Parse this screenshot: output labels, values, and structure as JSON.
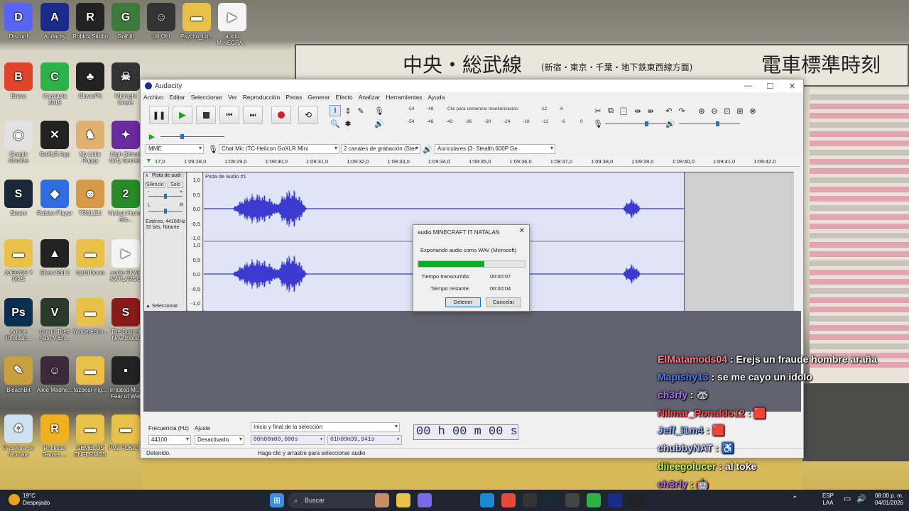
{
  "background_sign": {
    "text": "中央・総武線",
    "text2": "(新宿・東京・千葉・地下鉄東西線方面)",
    "text3": "電車標準時刻"
  },
  "desktop": {
    "icons": [
      {
        "label": "Discord",
        "color": "#5865f2",
        "glyph": "D"
      },
      {
        "label": "Audacity",
        "color": "#1a2b8a",
        "glyph": "A"
      },
      {
        "label": "Roblox Studio",
        "color": "#222",
        "glyph": "R"
      },
      {
        "label": "Golf It!",
        "color": "#3c7a3c",
        "glyph": "G"
      },
      {
        "label": "Uh Oh!",
        "color": "#333",
        "glyph": "☺"
      },
      {
        "label": "Psycho_Lo...",
        "color": "#e8c04a",
        "glyph": "▬"
      },
      {
        "label": "audio MINECRA...",
        "color": "#f4f4f4",
        "glyph": "▶"
      },
      {
        "label": "Brave",
        "color": "#e0442a",
        "glyph": "B"
      },
      {
        "label": "Camtasia 2019",
        "color": "#2db24a",
        "glyph": "C"
      },
      {
        "label": "CloverPit",
        "color": "#222",
        "glyph": "♣"
      },
      {
        "label": "Midnight Crane",
        "color": "#333",
        "glyph": "☠"
      },
      {
        "label": "Google Chrome",
        "color": "#e2e2e2",
        "glyph": "◉"
      },
      {
        "label": "GoXLR App",
        "color": "#222",
        "glyph": "✕"
      },
      {
        "label": "My Little Puppy",
        "color": "#e0b070",
        "glyph": "♞"
      },
      {
        "label": "High School Dirty Secrets",
        "color": "#6a2aa0",
        "glyph": "✦"
      },
      {
        "label": "Steam",
        "color": "#1b2838",
        "glyph": "S"
      },
      {
        "label": "Roblox Player",
        "color": "#2f6de0",
        "glyph": "◆"
      },
      {
        "label": "TROLEU",
        "color": "#d89a4a",
        "glyph": "☻"
      },
      {
        "label": "Violent Horror Sto...",
        "color": "#2a8a2a",
        "glyph": "2"
      },
      {
        "label": "JUEGOS Y MAS",
        "color": "#e8c04a",
        "glyph": "▬"
      },
      {
        "label": "Silent Still 2",
        "color": "#222",
        "glyph": "▲"
      },
      {
        "label": "UpOrDown",
        "color": "#e8c04a",
        "glyph": "▬"
      },
      {
        "label": "audio FNAF NATLARGO",
        "color": "#f4f4f4",
        "glyph": "▶"
      },
      {
        "label": "Adobe Photosh...",
        "color": "#0b2f4f",
        "glyph": "Ps"
      },
      {
        "label": "Grand Theft Auto V En...",
        "color": "#2a3a2a",
        "glyph": "V"
      },
      {
        "label": "YandereSim...",
        "color": "#e8c04a",
        "glyph": "▬"
      },
      {
        "label": "The Supper New Blood",
        "color": "#8a1a1a",
        "glyph": "S"
      },
      {
        "label": "BleachBit",
        "color": "#c8a040",
        "glyph": "✎"
      },
      {
        "label": "Alice Madne...",
        "color": "#3a2a3a",
        "glyph": "☺"
      },
      {
        "label": "fazbear-nig...",
        "color": "#e8c04a",
        "glyph": "▬"
      },
      {
        "label": "Irritated Mi... Fear of War",
        "color": "#222",
        "glyph": "▪"
      },
      {
        "label": "Papelera de reciclaje",
        "color": "#cfe0f0",
        "glyph": "♻"
      },
      {
        "label": "Rockstar Games ...",
        "color": "#f0b020",
        "glyph": "R"
      },
      {
        "label": "GEMELOS ENFERMOS",
        "color": "#e8c04a",
        "glyph": "▬"
      },
      {
        "label": "PVZ FUSION",
        "color": "#e8c04a",
        "glyph": "▬"
      }
    ]
  },
  "window": {
    "title": "Audacity",
    "controls": {
      "minimize": "—",
      "maximize": "☐",
      "close": "✕"
    },
    "menu": [
      "Archivo",
      "Editar",
      "Seleccionar",
      "Ver",
      "Reproducción",
      "Pistas",
      "Generar",
      "Efecto",
      "Analizar",
      "Herramientas",
      "Ayuda"
    ],
    "meter": {
      "click_text": "Clic para comenzar monitorización",
      "ticks_top": [
        "-54",
        "-48",
        "-12",
        "-6"
      ],
      "ticks_bottom": [
        "-54",
        "-48",
        "-42",
        "-36",
        "-30",
        "-24",
        "-18",
        "-12",
        "-6",
        "0"
      ]
    },
    "device": {
      "host": "MME",
      "mic": "Chat Mic (TC-Helicon GoXLR Mini",
      "channels": "2 canales de grabación (Ster",
      "output": "Auriculares (3- Stealth 600P Ge"
    },
    "ruler": {
      "start": "17,0",
      "ticks": [
        "1:09:28,0",
        "1:09:29,0",
        "1:09:30,0",
        "1:09:31,0",
        "1:09:32,0",
        "1:09:33,0",
        "1:09:34,0",
        "1:09:35,0",
        "1:09:36,0",
        "1:09:37,0",
        "1:09:38,0",
        "1:09:39,0",
        "1:09:40,0",
        "1:09:41,0",
        "1:09:42,0"
      ]
    },
    "track": {
      "menu_name": "Pista de audi",
      "name": "Pista de audio #1",
      "mute": "Silencio",
      "solo": "Solo",
      "gain_minus": "-",
      "gain_plus": "+",
      "pan_l": "L",
      "pan_r": "R",
      "format": "Estéreo, 44100Hz",
      "bits": "32 bits, flotante",
      "select": "Seleccionar",
      "close": "x",
      "scale": [
        "1,0",
        "0,5",
        "0,0",
        "-0,5",
        "-1,0"
      ]
    },
    "selection": {
      "rate_label": "Frecuencia (Hz)",
      "rate_value": "44100",
      "snap_label": "Ajuste",
      "snap_value": "Desactivado",
      "sel_label": "Inicio y final de la selección",
      "start": "00h00m00,000s",
      "end": "01h09m39,941s",
      "time": "00 h 00 m 00 s"
    },
    "status": {
      "state": "Detenido.",
      "hint": "Haga clic y arrastre para seleccionar audio"
    }
  },
  "dialog": {
    "title": "audio MINECRAFT IT NATALAN",
    "close": "✕",
    "message": "Exportando audio como WAV (Microsoft)",
    "progress": 0.62,
    "elapsed_label": "Tiempo transcurrido:",
    "elapsed": "00:00:07",
    "remaining_label": "Tiempo restante:",
    "remaining": "00:00:04",
    "stop": "Detener",
    "cancel": "Cancelar"
  },
  "chat": [
    {
      "user": "ElMatamods04",
      "color": "#ff7a8a",
      "msg": ": Erejs un fraude hombre araña"
    },
    {
      "user": "Mapishy13",
      "color": "#4d7dff",
      "msg": ": se me cayo un idolo"
    },
    {
      "user": "ch3rfy",
      "color": "#b06cff",
      "msg": ": 🦝"
    },
    {
      "user": "Nilmar_Ronaldo12",
      "color": "#ff4d4d",
      "msg": ": 🟥"
    },
    {
      "user": "Jeff_l1m4",
      "color": "#8fb0ff",
      "msg": ": 🟥"
    },
    {
      "user": "chubbyNAT",
      "color": "#c8c8ff",
      "msg": ": ♿"
    },
    {
      "user": "diieegolucer",
      "color": "#c8ff4d",
      "msg": ": al toke"
    },
    {
      "user": "ch3rfy",
      "color": "#b06cff",
      "msg": ": 🤖"
    }
  ],
  "taskbar": {
    "weather_temp": "19°C",
    "weather_desc": "Despejado",
    "search": "Buscar",
    "lang": "ESP",
    "lang2": "LAA",
    "time": "08:00 p. m.",
    "date": "04/01/2026"
  }
}
